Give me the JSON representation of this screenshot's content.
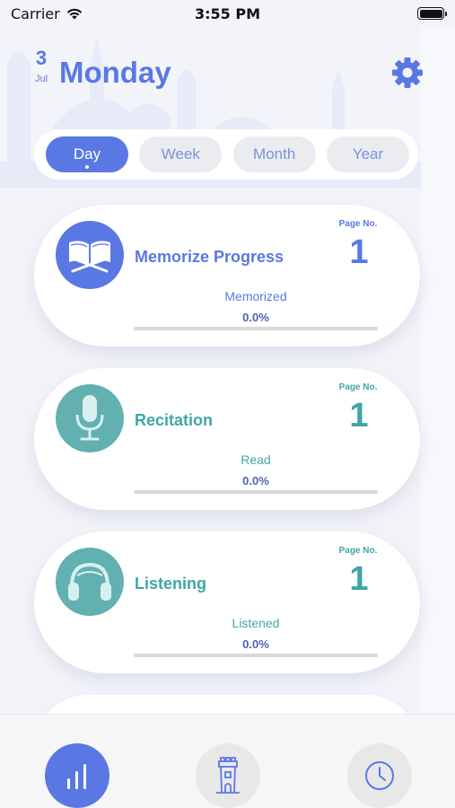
{
  "status_bar": {
    "carrier": "Carrier",
    "time": "3:55 PM"
  },
  "header": {
    "date_day": "3",
    "date_month": "Jul",
    "weekday": "Monday"
  },
  "period_tabs": [
    {
      "label": "Day",
      "active": true
    },
    {
      "label": "Week",
      "active": false
    },
    {
      "label": "Month",
      "active": false
    },
    {
      "label": "Year",
      "active": false
    }
  ],
  "cards": [
    {
      "title": "Memorize Progress",
      "icon": "quran-book-icon",
      "page_label": "Page No.",
      "page_number": "1",
      "stat_label": "Memorized",
      "stat_value": "0.0%",
      "progress": 0.0,
      "accent": "#5a78e4"
    },
    {
      "title": "Recitation",
      "icon": "microphone-icon",
      "page_label": "Page No.",
      "page_number": "1",
      "stat_label": "Read",
      "stat_value": "0.0%",
      "progress": 0.0,
      "accent": "#63b0b0"
    },
    {
      "title": "Listening",
      "icon": "headphones-icon",
      "page_label": "Page No.",
      "page_number": "1",
      "stat_label": "Listened",
      "stat_value": "0.0%",
      "progress": 0.0,
      "accent": "#63b0b0"
    }
  ],
  "tab_bar": [
    {
      "icon": "stats-bars-icon",
      "active": true
    },
    {
      "icon": "minaret-icon",
      "active": false
    },
    {
      "icon": "clock-icon",
      "active": false
    }
  ],
  "colors": {
    "primary": "#5a78e4",
    "teal": "#63b0b0",
    "background": "#f3f4f9"
  }
}
